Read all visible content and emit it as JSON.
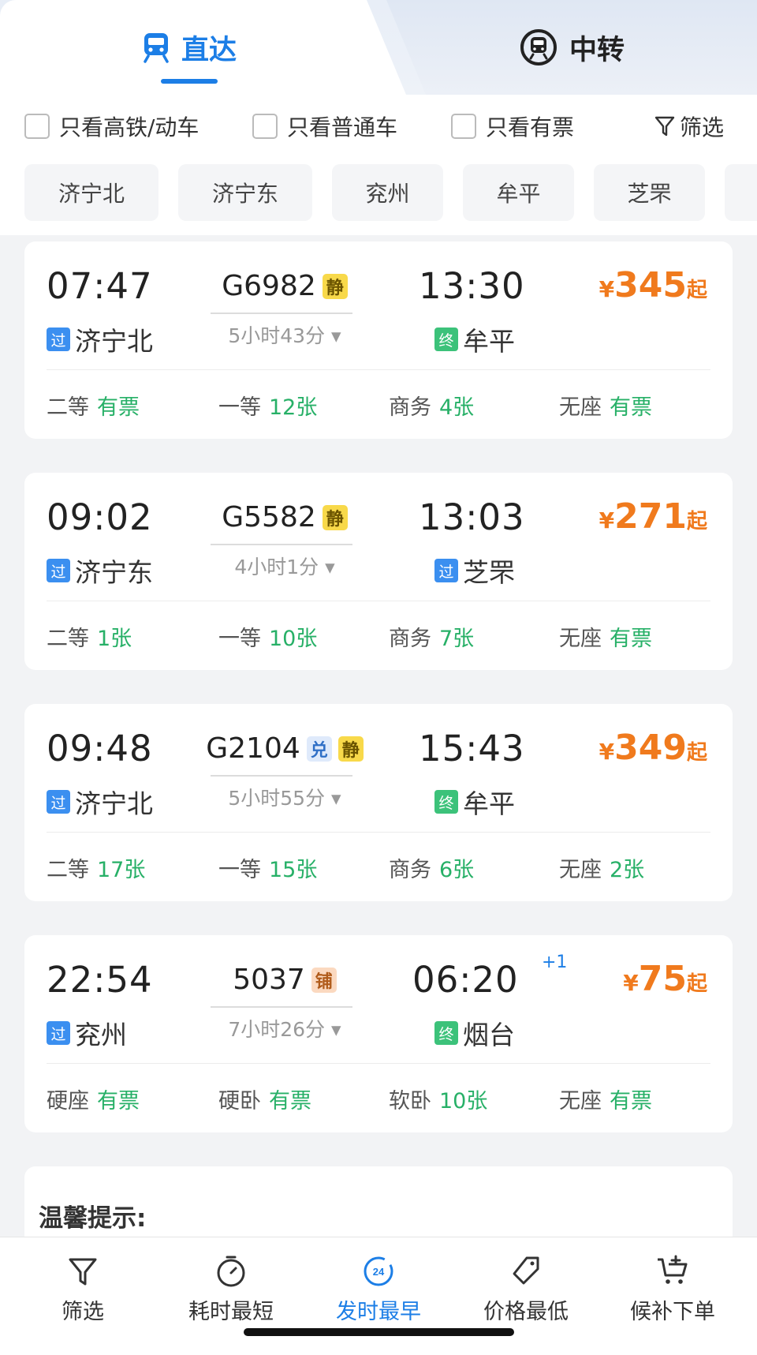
{
  "tabs": {
    "direct": "直达",
    "transfer": "中转"
  },
  "filters": {
    "only_gaotie": "只看高铁/动车",
    "only_putong": "只看普通车",
    "only_tickets": "只看有票",
    "filter_label": "筛选"
  },
  "stations": [
    "济宁北",
    "济宁东",
    "兖州",
    "牟平",
    "芝罘"
  ],
  "trains": [
    {
      "dep_time": "07:47",
      "train_no": "G6982",
      "tags": [
        "静"
      ],
      "duration": "5小时43分",
      "arr_time": "13:30",
      "next_day": "",
      "dep_station": "济宁北",
      "dep_badge": "过",
      "arr_station": "牟平",
      "arr_badge": "终",
      "price": "345",
      "price_yen": "¥",
      "price_suffix": "起",
      "seats": [
        {
          "name": "二等",
          "avail": "有票"
        },
        {
          "name": "一等",
          "avail": "12张"
        },
        {
          "name": "商务",
          "avail": "4张"
        },
        {
          "name": "无座",
          "avail": "有票"
        }
      ]
    },
    {
      "dep_time": "09:02",
      "train_no": "G5582",
      "tags": [
        "静"
      ],
      "duration": "4小时1分",
      "arr_time": "13:03",
      "next_day": "",
      "dep_station": "济宁东",
      "dep_badge": "过",
      "arr_station": "芝罘",
      "arr_badge": "过",
      "price": "271",
      "price_yen": "¥",
      "price_suffix": "起",
      "seats": [
        {
          "name": "二等",
          "avail": "1张"
        },
        {
          "name": "一等",
          "avail": "10张"
        },
        {
          "name": "商务",
          "avail": "7张"
        },
        {
          "name": "无座",
          "avail": "有票"
        }
      ]
    },
    {
      "dep_time": "09:48",
      "train_no": "G2104",
      "tags": [
        "兑",
        "静"
      ],
      "duration": "5小时55分",
      "arr_time": "15:43",
      "next_day": "",
      "dep_station": "济宁北",
      "dep_badge": "过",
      "arr_station": "牟平",
      "arr_badge": "终",
      "price": "349",
      "price_yen": "¥",
      "price_suffix": "起",
      "seats": [
        {
          "name": "二等",
          "avail": "17张"
        },
        {
          "name": "一等",
          "avail": "15张"
        },
        {
          "name": "商务",
          "avail": "6张"
        },
        {
          "name": "无座",
          "avail": "2张"
        }
      ]
    },
    {
      "dep_time": "22:54",
      "train_no": "5037",
      "tags": [
        "铺"
      ],
      "duration": "7小时26分",
      "arr_time": "06:20",
      "next_day": "+1",
      "dep_station": "兖州",
      "dep_badge": "过",
      "arr_station": "烟台",
      "arr_badge": "终",
      "price": "75",
      "price_yen": "¥",
      "price_suffix": "起",
      "seats": [
        {
          "name": "硬座",
          "avail": "有票"
        },
        {
          "name": "硬卧",
          "avail": "有票"
        },
        {
          "name": "软卧",
          "avail": "10张"
        },
        {
          "name": "无座",
          "avail": "有票"
        }
      ]
    }
  ],
  "tip": {
    "title": "温馨提示:"
  },
  "bottom_bar": {
    "filter": "筛选",
    "shortest": "耗时最短",
    "earliest": "发时最早",
    "earliest_icon_text": "24",
    "cheapest": "价格最低",
    "waitlist": "候补下单"
  },
  "colors": {
    "accent": "#1c7ee6",
    "price": "#f07a1d",
    "available": "#27b067",
    "badge_pass": "#3b8ff0",
    "badge_end": "#3cc27a"
  }
}
